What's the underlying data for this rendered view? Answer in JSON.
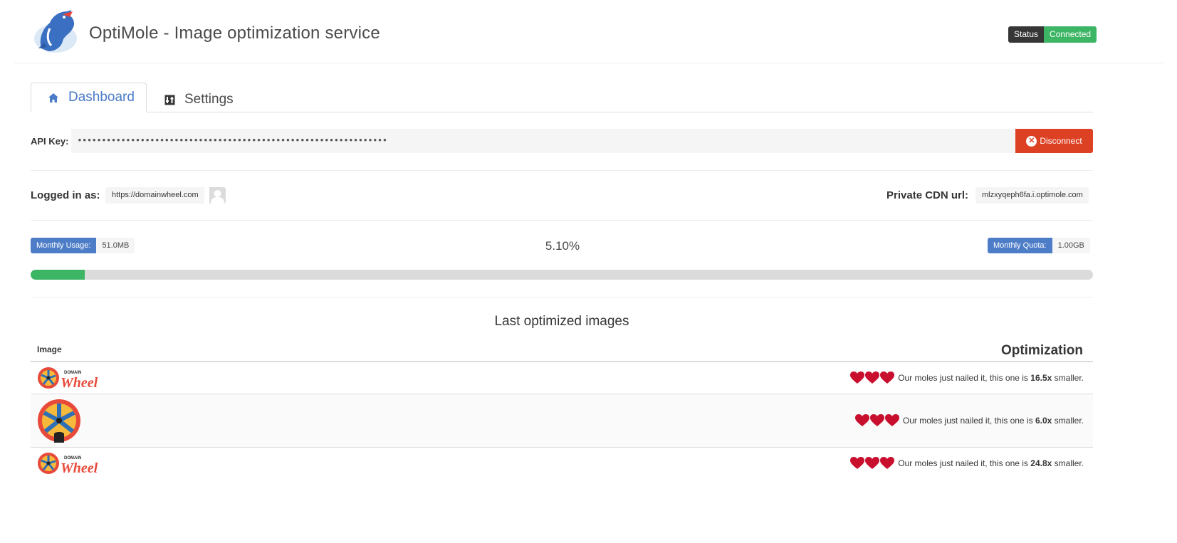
{
  "app": {
    "title": "OptiMole - Image optimization service"
  },
  "status": {
    "key": "Status",
    "value": "Connected"
  },
  "tabs": [
    {
      "label": "Dashboard",
      "icon": "home-icon",
      "active": true
    },
    {
      "label": "Settings",
      "icon": "sliders-icon",
      "active": false
    }
  ],
  "api": {
    "label": "API Key:",
    "value": "••••••••••••••••••••••••••••••••••••••••••••••••••••••••••••••••",
    "disconnect_label": "Disconnect"
  },
  "account": {
    "logged_in_label": "Logged in as:",
    "logged_in_value": "https://domainwheel.com",
    "cdn_label": "Private CDN url:",
    "cdn_value": "mlzxyqeph6fa.i.optimole.com"
  },
  "usage": {
    "monthly_usage_label": "Monthly Usage:",
    "monthly_usage_value": "51.0MB",
    "percent_text": "5.10%",
    "percent": 5.1,
    "monthly_quota_label": "Monthly Quota:",
    "monthly_quota_value": "1.00GB"
  },
  "table": {
    "title": "Last optimized images",
    "col_image": "Image",
    "col_optimization": "Optimization",
    "rows": [
      {
        "thumb": "domainwheel-logo-wordmark",
        "prefix": "Our moles just nailed it, this one is",
        "ratio": "16.5x",
        "suffix": "smaller."
      },
      {
        "thumb": "domainwheel-wheel-icon",
        "prefix": "Our moles just nailed it, this one is",
        "ratio": "6.0x",
        "suffix": "smaller."
      },
      {
        "thumb": "domainwheel-logo-wordmark",
        "prefix": "Our moles just nailed it, this one is",
        "ratio": "24.8x",
        "suffix": "smaller."
      }
    ]
  },
  "colors": {
    "accent_blue": "#4d7dc7",
    "success_green": "#3cb564",
    "danger_red": "#dd4124",
    "heart_red": "#c8102e"
  }
}
